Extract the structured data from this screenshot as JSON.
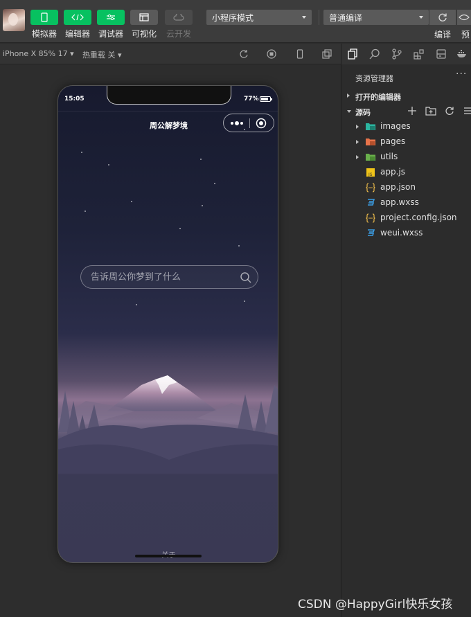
{
  "toolbar": {
    "tools": [
      {
        "label": "模拟器",
        "icon": "phone-icon"
      },
      {
        "label": "编辑器",
        "icon": "code-icon"
      },
      {
        "label": "调试器",
        "icon": "debug-icon"
      },
      {
        "label": "可视化",
        "icon": "layout-icon"
      },
      {
        "label": "云开发",
        "icon": "cloud-icon"
      }
    ],
    "mode_select": "小程序模式",
    "compile_select": "普通编译",
    "compile_label": "编译",
    "preview_label": "预"
  },
  "simulator_bar": {
    "device": "iPhone X 85% 17",
    "hot_reload": "热重载 关"
  },
  "phone": {
    "time": "15:05",
    "battery": "77%",
    "nav_title": "周公解梦境",
    "search_placeholder": "告诉周公你梦到了什么",
    "footer_label": "关于"
  },
  "explorer": {
    "title": "资源管理器",
    "more": "···",
    "section_open_editors": "打开的编辑器",
    "section_source": "源码",
    "items": [
      {
        "name": "images",
        "type": "folder",
        "icon": "images-folder-icon",
        "color": "#2bb5a0"
      },
      {
        "name": "pages",
        "type": "folder",
        "icon": "pages-folder-icon",
        "color": "#e8734a"
      },
      {
        "name": "utils",
        "type": "folder",
        "icon": "utils-folder-icon",
        "color": "#6ab04c"
      },
      {
        "name": "app.js",
        "type": "file",
        "icon": "js-file-icon",
        "color": "#f0c419"
      },
      {
        "name": "app.json",
        "type": "file",
        "icon": "json-file-icon",
        "color": "#e8b84a"
      },
      {
        "name": "app.wxss",
        "type": "file",
        "icon": "css-file-icon",
        "color": "#3b9ce2"
      },
      {
        "name": "project.config.json",
        "type": "file",
        "icon": "json-file-icon",
        "color": "#e8b84a"
      },
      {
        "name": "weui.wxss",
        "type": "file",
        "icon": "css-file-icon",
        "color": "#3b9ce2"
      }
    ]
  },
  "watermark": "CSDN @HappyGirl快乐女孩"
}
